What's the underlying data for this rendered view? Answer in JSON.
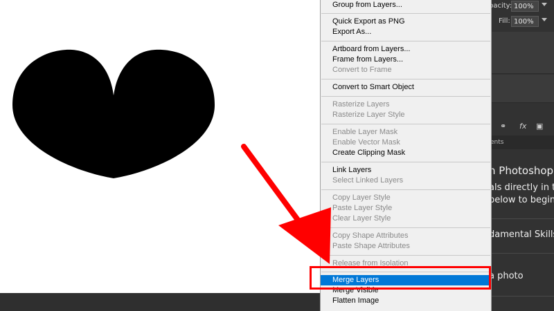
{
  "canvas": {
    "background": "#ffffff",
    "shape_color": "#000000"
  },
  "context_menu": {
    "items": [
      {
        "label": "Group from Layers...",
        "enabled": true
      },
      {
        "label": "Quick Export as PNG",
        "enabled": true
      },
      {
        "label": "Export As...",
        "enabled": true
      },
      {
        "label": "Artboard from Layers...",
        "enabled": true
      },
      {
        "label": "Frame from Layers...",
        "enabled": true
      },
      {
        "label": "Convert to Frame",
        "enabled": false
      },
      {
        "label": "Convert to Smart Object",
        "enabled": true
      },
      {
        "label": "Rasterize Layers",
        "enabled": false
      },
      {
        "label": "Rasterize Layer Style",
        "enabled": false
      },
      {
        "label": "Enable Layer Mask",
        "enabled": false
      },
      {
        "label": "Enable Vector Mask",
        "enabled": false
      },
      {
        "label": "Create Clipping Mask",
        "enabled": true
      },
      {
        "label": "Link Layers",
        "enabled": true
      },
      {
        "label": "Select Linked Layers",
        "enabled": false
      },
      {
        "label": "Copy Layer Style",
        "enabled": false
      },
      {
        "label": "Paste Layer Style",
        "enabled": false
      },
      {
        "label": "Clear Layer Style",
        "enabled": false
      },
      {
        "label": "Copy Shape Attributes",
        "enabled": false
      },
      {
        "label": "Paste Shape Attributes",
        "enabled": false
      },
      {
        "label": "Release from Isolation",
        "enabled": false
      },
      {
        "label": "Merge Layers",
        "enabled": true,
        "selected": true
      },
      {
        "label": "Merge Visible",
        "enabled": true
      },
      {
        "label": "Flatten Image",
        "enabled": true
      }
    ],
    "selection_color": "#0078d7"
  },
  "layers_panel": {
    "opacity_label": "pacity:",
    "opacity_value": "100%",
    "fill_label": "Fill:",
    "fill_value": "100%",
    "tab_label": "ents"
  },
  "learn_panel": {
    "title": "n Photoshop",
    "line1": "als directly in the",
    "line2": "below to begin.",
    "section1": "damental Skills",
    "section2": "a photo"
  },
  "annotations": {
    "arrow_color": "#ff0000",
    "highlight_color": "#ff0000"
  }
}
